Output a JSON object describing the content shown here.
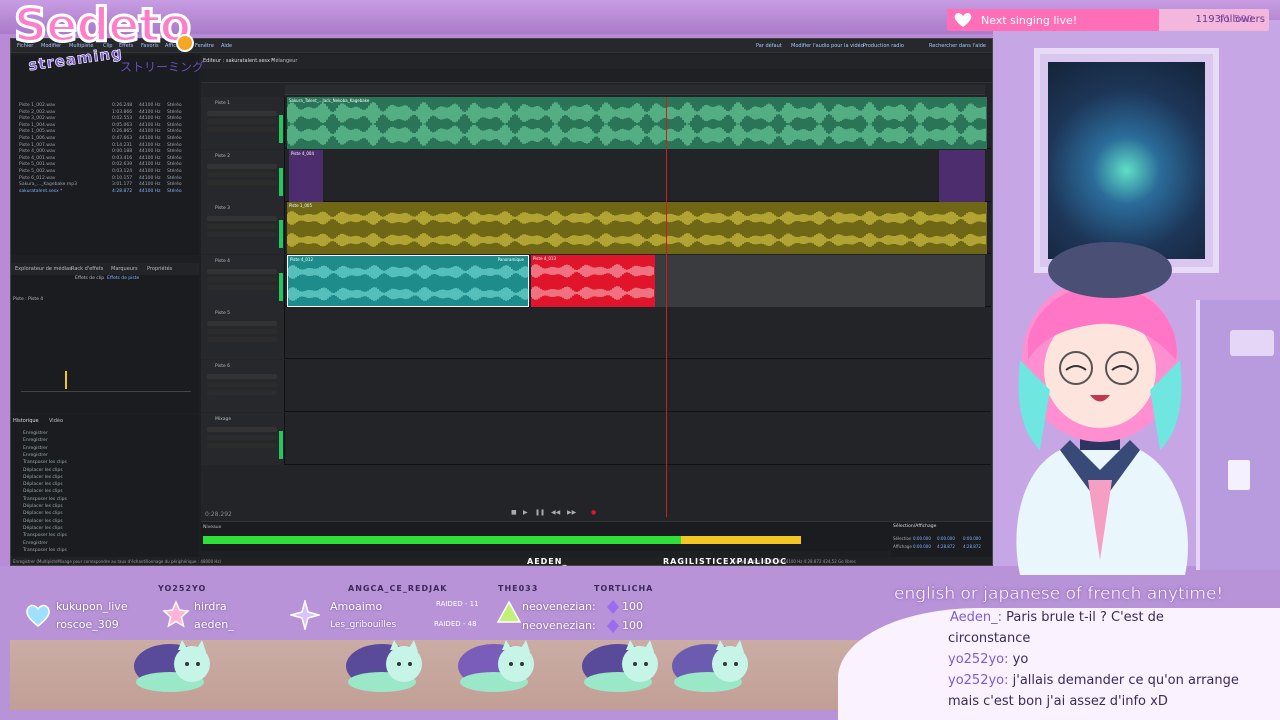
{
  "branding": {
    "logo_text": "Sedeto",
    "logo_sub": "streaming",
    "logo_jp": "ストリーミング"
  },
  "notification": {
    "label": "Next singing live!",
    "count": "1193",
    "total": "/1 500",
    "suffix": "followers"
  },
  "daw": {
    "menu": [
      "Fichier",
      "Modifier",
      "Multipiste",
      "Clip",
      "Effets",
      "Favoris",
      "Affichage",
      "Fenêtre",
      "Aide"
    ],
    "right_menu": [
      "Par défaut",
      "Modifier l'audio pour la vidéo",
      "Production radio",
      "Rechercher dans l'aide"
    ],
    "editor_tab": "Editeur : sakuratalent.sesx *",
    "mixer_tab": "Mélangeur",
    "files": [
      {
        "name": "Piste 1_002.wav",
        "dur": "0:26.248",
        "rate": "44100 Hz",
        "ch": "Stéréo"
      },
      {
        "name": "Piste 2_002.wav",
        "dur": "1:03.866",
        "rate": "44100 Hz",
        "ch": "Stéréo"
      },
      {
        "name": "Piste 3_002.wav",
        "dur": "0:02.553",
        "rate": "44100 Hz",
        "ch": "Stéréo"
      },
      {
        "name": "Piste 1_004.wav",
        "dur": "0:05.063",
        "rate": "44100 Hz",
        "ch": "Stéréo"
      },
      {
        "name": "Piste 1_005.wav",
        "dur": "0:26.865",
        "rate": "44100 Hz",
        "ch": "Stéréo"
      },
      {
        "name": "Piste 1_006.wav",
        "dur": "0:47.663",
        "rate": "44100 Hz",
        "ch": "Stéréo"
      },
      {
        "name": "Piste 1_007.wav",
        "dur": "0:14.231",
        "rate": "44100 Hz",
        "ch": "Stéréo"
      },
      {
        "name": "Piste 4_000.wav",
        "dur": "0:00.188",
        "rate": "44100 Hz",
        "ch": "Stéréo"
      },
      {
        "name": "Piste 4_001.wav",
        "dur": "0:03.416",
        "rate": "44100 Hz",
        "ch": "Stéréo"
      },
      {
        "name": "Piste 5_001.wav",
        "dur": "0:02.639",
        "rate": "44100 Hz",
        "ch": "Stéréo"
      },
      {
        "name": "Piste 5_002.wav",
        "dur": "0:03.124",
        "rate": "44100 Hz",
        "ch": "Stéréo"
      },
      {
        "name": "Piste 6_012.wav",
        "dur": "0:10.157",
        "rate": "44100 Hz",
        "ch": "Stéréo"
      },
      {
        "name": "Sakura_..._Kagebake.mp3",
        "dur": "3:01.177",
        "rate": "44100 Hz",
        "ch": "Stéréo"
      },
      {
        "name": "sakuratalent.sesx *",
        "dur": "4:28.872",
        "rate": "44100 Hz",
        "ch": "Stéréo"
      }
    ],
    "panel_tabs": [
      "Explorateur de médias",
      "Rack d'effets",
      "Marqueurs",
      "Propriétés"
    ],
    "clip_effects": [
      "Effets de clip",
      "Effets de piste"
    ],
    "rack_track": "Piste : Piste 4",
    "history_title": "Historique",
    "video_tab": "Vidéo",
    "history": [
      "Enregistrer",
      "Enregistrer",
      "Enregistrer",
      "Enregistrer",
      "Transposer les clips",
      "Déplacer les clips",
      "Déplacer les clips",
      "Déplacer les clips",
      "Déplacer les clips",
      "Transposer les clips",
      "Déplacer les clips",
      "Déplacer les clips",
      "Déplacer les clips",
      "Déplacer les clips",
      "Transposer les clips",
      "Enregistrer",
      "Transposer les clips"
    ],
    "tracks": [
      {
        "name": "Piste 1",
        "clip": "Sakura_Talent_...Jack_Nekoba_Kagebake",
        "color": "#2f9a6d"
      },
      {
        "name": "Piste 2",
        "clip": "Piste 4_004",
        "color": "#6a3d8f"
      },
      {
        "name": "Piste 3",
        "clip": "Piste 1_005",
        "color": "#b5a825"
      },
      {
        "name": "Piste 4",
        "clip": "Piste 4_012",
        "clip2": "Piste 4_013",
        "fx": "Panoramique",
        "color": "#1e8c8a"
      },
      {
        "name": "Piste 5",
        "clip": "",
        "color": "#2a2b2e"
      },
      {
        "name": "Piste 6",
        "clip": "",
        "color": "#2a2b2e"
      },
      {
        "name": "Mixage",
        "clip": "",
        "color": "#2a2b2e"
      }
    ],
    "meter_label": "Niveaux",
    "selection_title": "Sélection/Affichage",
    "selection_rows": [
      {
        "label": "Sélection",
        "start": "0:00.000",
        "end": "0:00.000",
        "dur": "0:00.000"
      },
      {
        "label": "Affichage",
        "start": "0:00.000",
        "end": "4:28.872",
        "dur": "4:28.872"
      }
    ],
    "status_left": "Enregistrer (MultipisteMixage pour correspondre au taux d'échantillonnage du périphérique : 48000 Hz)",
    "status_right": "Mixage 32 bits, 44100 Hz   44100 Hz   4:28.872   424,52 Go libres",
    "time": "0:28.292"
  },
  "alerts": {
    "heads": [
      "YO252YO",
      "ANGCA_CE_REDJAK",
      "THE033",
      "TORTLICHA"
    ],
    "follows": [
      "kukupon_live",
      "roscoe_309"
    ],
    "subs": [
      "hirdra",
      "aeden_"
    ],
    "raids": [
      {
        "name": "Amoaimo",
        "label": "RAIDED - 11"
      },
      {
        "name": "Les_gribouilles",
        "label": "RAIDED - 48"
      }
    ],
    "bits": [
      {
        "name": "neovenezian:",
        "amount": "100"
      },
      {
        "name": "neovenezian:",
        "amount": "100"
      }
    ]
  },
  "overlay_names": [
    "AEDEN_",
    "RAGILISTICEXPIALIDOC"
  ],
  "chat": {
    "banner": "english or japanese of french anytime!",
    "messages": [
      {
        "user": "Aeden_:",
        "text": " Paris brule t-il ? C'est de"
      },
      {
        "user": "",
        "text": "circonstance"
      },
      {
        "user": "yo252yo:",
        "text": " yo"
      },
      {
        "user": "yo252yo:",
        "text": " j'allais demander ce qu'on arrange"
      },
      {
        "user": "",
        "text": "mais c'est bon j'ai assez d'info xD"
      }
    ]
  },
  "colors": {
    "pink": "#ff6fb7",
    "purple": "#7b5bd6",
    "green": "#22c55e",
    "yellow": "#f3c623",
    "red": "#e0142a"
  }
}
